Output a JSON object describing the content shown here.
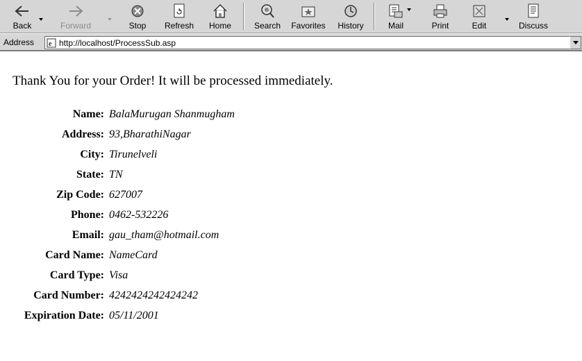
{
  "toolbar": {
    "back": "Back",
    "forward": "Forward",
    "stop": "Stop",
    "refresh": "Refresh",
    "home": "Home",
    "search": "Search",
    "favorites": "Favorites",
    "history": "History",
    "mail": "Mail",
    "print": "Print",
    "edit": "Edit",
    "discuss": "Discuss"
  },
  "address": {
    "label": "Address",
    "url": "http://localhost/ProcessSub.asp"
  },
  "page": {
    "message": "Thank You for your Order! It will be processed immediately.",
    "fields": [
      {
        "label": "Name:",
        "value": "BalaMurugan Shanmugham"
      },
      {
        "label": "Address:",
        "value": "93,BharathiNagar"
      },
      {
        "label": "City:",
        "value": "Tirunelveli"
      },
      {
        "label": "State:",
        "value": "TN"
      },
      {
        "label": "Zip Code:",
        "value": "627007"
      },
      {
        "label": "Phone:",
        "value": "0462-532226"
      },
      {
        "label": "Email:",
        "value": "gau_tham@hotmail.com"
      },
      {
        "label": "Card Name:",
        "value": "NameCard"
      },
      {
        "label": "Card Type:",
        "value": "Visa"
      },
      {
        "label": "Card Number:",
        "value": "4242424242424242"
      },
      {
        "label": "Expiration Date:",
        "value": "05/11/2001"
      }
    ]
  }
}
